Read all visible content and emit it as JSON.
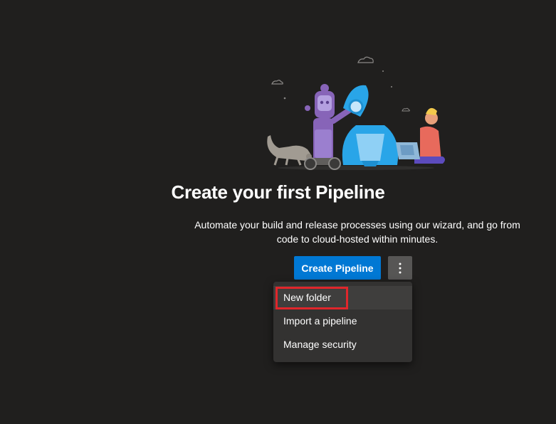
{
  "empty_state": {
    "title": "Create your first Pipeline",
    "description": "Automate your build and release processes using our wizard, and go from code to cloud-hosted within minutes."
  },
  "actions": {
    "create_pipeline_label": "Create Pipeline",
    "more_actions_icon": "more-vertical-icon"
  },
  "menu": {
    "items": [
      {
        "label": "New folder",
        "highlighted": true
      },
      {
        "label": "Import a pipeline",
        "highlighted": false
      },
      {
        "label": "Manage security",
        "highlighted": false
      }
    ]
  },
  "colors": {
    "background": "#201f1e",
    "primary_button": "#0078d4",
    "secondary_button": "#575655",
    "menu_background": "#333231",
    "annotation_red": "#e0262b"
  },
  "illustration": {
    "icon": "pipeline-illustration"
  }
}
